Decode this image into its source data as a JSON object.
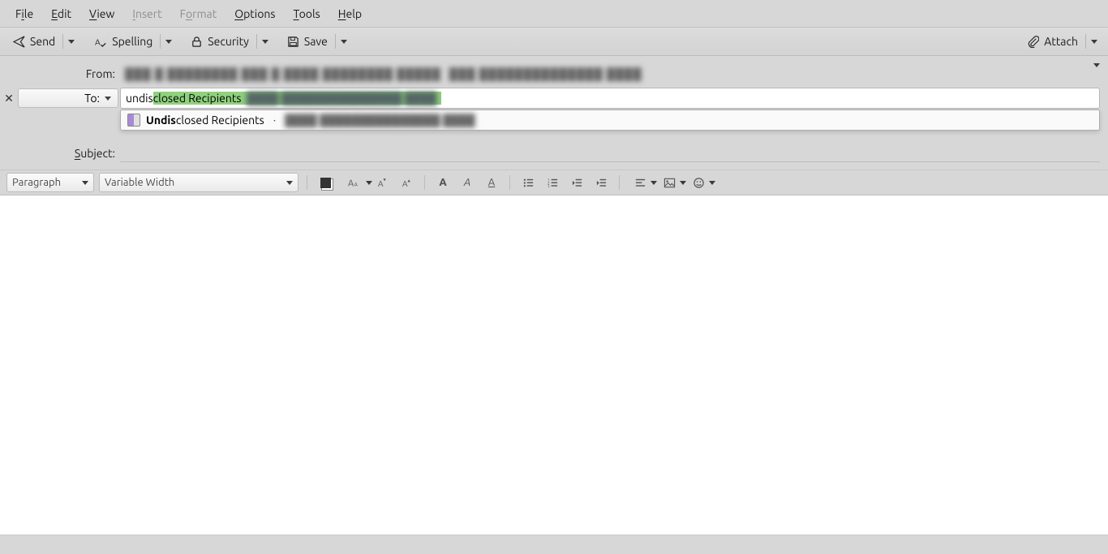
{
  "menubar": {
    "file": {
      "pre": "F",
      "ul": "i",
      "post": "le",
      "disabled": false
    },
    "edit": {
      "pre": "",
      "ul": "E",
      "post": "dit",
      "disabled": false
    },
    "view": {
      "pre": "",
      "ul": "V",
      "post": "iew",
      "disabled": false
    },
    "insert": {
      "pre": "",
      "ul": "I",
      "post": "nsert",
      "disabled": true
    },
    "format": {
      "pre": "F",
      "ul": "o",
      "post": "rmat",
      "disabled": true
    },
    "options": {
      "pre": "",
      "ul": "O",
      "post": "ptions",
      "disabled": false
    },
    "tools": {
      "pre": "",
      "ul": "T",
      "post": "ools",
      "disabled": false
    },
    "help": {
      "pre": "",
      "ul": "H",
      "post": "elp",
      "disabled": false
    }
  },
  "toolbar": {
    "send": "Send",
    "spelling": "Spelling",
    "security": "Security",
    "save": "Save",
    "attach": "Attach"
  },
  "headers": {
    "from_label": "From:",
    "to_label": "To:",
    "subject_label": {
      "pre": "",
      "ul": "S",
      "post": "ubject:"
    },
    "to_typed": "undis",
    "to_completion_text": "closed Recipients",
    "to_completion_extra_redacted": "████ ███████████████ ████",
    "from_redacted_a": "███ █ ████████ ███ █ ████ ████████ █████",
    "from_redacted_b": "███ ██████████████ ████"
  },
  "autocomplete": {
    "bold": "Undis",
    "rest": "closed Recipients",
    "sep": "·",
    "redacted": "████ ███████████████ ████"
  },
  "format_toolbar": {
    "paragraph": "Paragraph",
    "font": "Variable Width"
  },
  "icons": {
    "x": "✕",
    "bold": "A",
    "italic": "A",
    "underline": "A",
    "size_small": "A",
    "size_big": "A",
    "smiley": "☺"
  }
}
